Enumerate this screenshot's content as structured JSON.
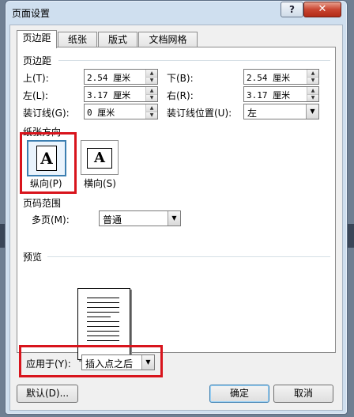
{
  "window": {
    "title": "页面设置",
    "help": "?",
    "close": "✕"
  },
  "tabs": [
    {
      "label": "页边距",
      "active": true
    },
    {
      "label": "纸张",
      "active": false
    },
    {
      "label": "版式",
      "active": false
    },
    {
      "label": "文档网格",
      "active": false
    }
  ],
  "margins": {
    "group": "页边距",
    "top_label": "上(T):",
    "top_value": "2.54 厘米",
    "bottom_label": "下(B):",
    "bottom_value": "2.54 厘米",
    "left_label": "左(L):",
    "left_value": "3.17 厘米",
    "right_label": "右(R):",
    "right_value": "3.17 厘米",
    "gutter_label": "装订线(G):",
    "gutter_value": "0 厘米",
    "gutter_pos_label": "装订线位置(U):",
    "gutter_pos_value": "左"
  },
  "orientation": {
    "group": "纸张方向",
    "portrait_label": "纵向(P)",
    "landscape_label": "横向(S)",
    "icon_letter": "A",
    "selected": "portrait"
  },
  "pages": {
    "group": "页码范围",
    "multi_label": "多页(M):",
    "multi_value": "普通"
  },
  "preview": {
    "group": "预览"
  },
  "apply": {
    "label": "应用于(Y):",
    "value": "插入点之后"
  },
  "buttons": {
    "default_label": "默认(D)...",
    "ok_label": "确定",
    "cancel_label": "取消"
  },
  "colors": {
    "highlight": "#d8141c",
    "selected_border": "#3c7fb1"
  }
}
